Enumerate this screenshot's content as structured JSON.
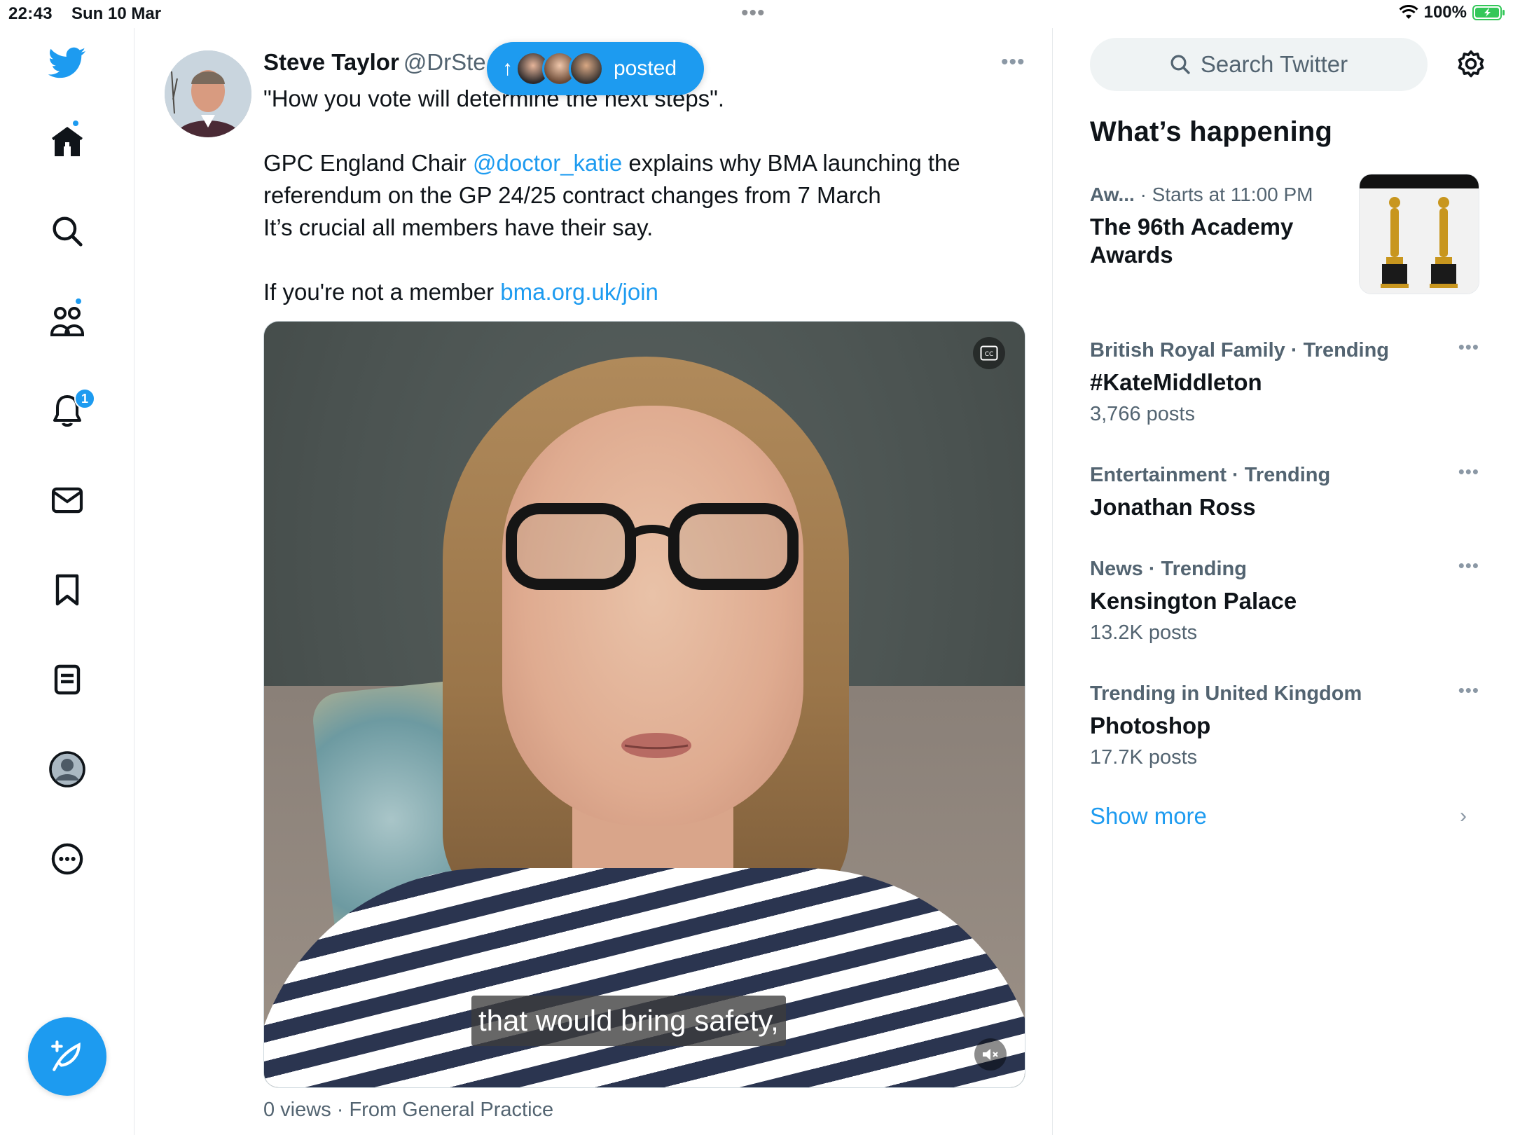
{
  "status_bar": {
    "time": "22:43",
    "date": "Sun 10 Mar",
    "battery": "100%"
  },
  "nav": {
    "notifications_badge": "1",
    "accent_color": "#1d9bf0"
  },
  "tweet": {
    "author_name": "Steve Taylor",
    "author_handle": "@DrSte",
    "line1": "\"How you vote will determine the next steps\".",
    "para2_pre": "GPC England Chair ",
    "mention": "@doctor_katie",
    "para2_post": " explains why BMA launching the referendum on the GP 24/25 contract changes from 7 March",
    "para3": "It’s crucial all members have their say.",
    "para4_pre": "If you're not a member ",
    "link": "bma.org.uk/join",
    "video_caption": "that would bring safety,",
    "views_line": "0 views · From General Practice"
  },
  "new_posts_pill": {
    "label": "posted"
  },
  "sidebar": {
    "search_placeholder": "Search Twitter",
    "section_title": "What’s happening",
    "featured": {
      "category": "Aw...",
      "time": " · Starts at 11:00 PM",
      "title": "The 96th Academy Awards"
    },
    "trends": [
      {
        "meta": "British Royal Family · Trending",
        "title": "#KateMiddleton",
        "count": "3,766 posts"
      },
      {
        "meta": "Entertainment · Trending",
        "title": "Jonathan Ross",
        "count": ""
      },
      {
        "meta": "News · Trending",
        "title": "Kensington Palace",
        "count": "13.2K posts"
      },
      {
        "meta": "Trending in United Kingdom",
        "title": "Photoshop",
        "count": "17.7K posts"
      }
    ],
    "show_more": "Show more"
  }
}
